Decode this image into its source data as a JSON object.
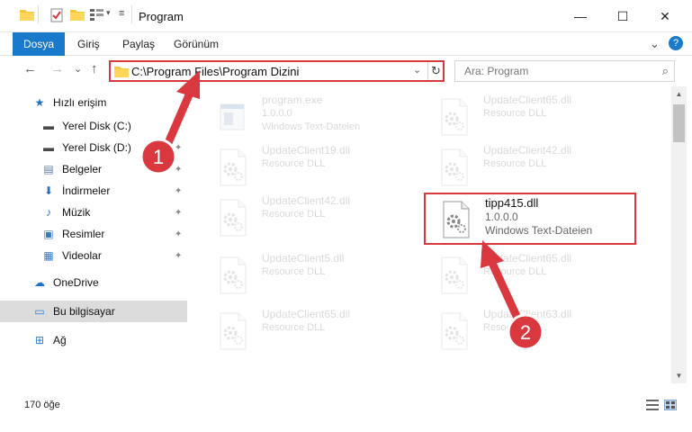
{
  "window": {
    "title": "Program",
    "min_glyph": "—",
    "max_glyph": "☐",
    "close_glyph": "✕"
  },
  "ribbon": {
    "tabs": [
      "Dosya",
      "Giriş",
      "Paylaş",
      "Görünüm"
    ],
    "expand_glyph": "⌄",
    "help_glyph": "?"
  },
  "navigation": {
    "back_glyph": "←",
    "forward_glyph": "→",
    "recent_glyph": "⌄",
    "up_glyph": "↑",
    "address": "C:\\Program Files\\Program Dizini",
    "address_chevron": "⌄",
    "refresh_glyph": "↻",
    "search_placeholder": "Ara: Program",
    "search_glyph": "⌕"
  },
  "sidebar": {
    "items": [
      {
        "label": "Hızlı erişim",
        "icon": "star-icon",
        "glyph": "★",
        "color": "#1f6fc5",
        "pinned": false,
        "selected": false
      },
      {
        "label": "Yerel Disk (C:)",
        "icon": "drive-icon",
        "glyph": "▬",
        "color": "#4a4a4a",
        "pinned": true,
        "selected": false
      },
      {
        "label": "Yerel Disk (D:)",
        "icon": "drive-icon",
        "glyph": "▬",
        "color": "#4a4a4a",
        "pinned": true,
        "selected": false
      },
      {
        "label": "Belgeler",
        "icon": "document-icon",
        "glyph": "▤",
        "color": "#5b7fa8",
        "pinned": true,
        "selected": false
      },
      {
        "label": "İndirmeler",
        "icon": "download-icon",
        "glyph": "⬇",
        "color": "#1f6fc5",
        "pinned": true,
        "selected": false
      },
      {
        "label": "Müzik",
        "icon": "music-icon",
        "glyph": "♪",
        "color": "#1f6fc5",
        "pinned": true,
        "selected": false
      },
      {
        "label": "Resimler",
        "icon": "pictures-icon",
        "glyph": "▣",
        "color": "#3a7bbf",
        "pinned": true,
        "selected": false
      },
      {
        "label": "Videolar",
        "icon": "video-icon",
        "glyph": "▦",
        "color": "#3a7bbf",
        "pinned": true,
        "selected": false
      },
      {
        "label": "OneDrive",
        "icon": "cloud-icon",
        "glyph": "☁",
        "color": "#1f6fc5",
        "pinned": false,
        "selected": false
      },
      {
        "label": "Bu bilgisayar",
        "icon": "computer-icon",
        "glyph": "▭",
        "color": "#2f7fd1",
        "pinned": false,
        "selected": true
      },
      {
        "label": "Ağ",
        "icon": "network-icon",
        "glyph": "⊞",
        "color": "#2f7fd1",
        "pinned": false,
        "selected": false
      }
    ],
    "pin_glyph": "📌"
  },
  "files": [
    {
      "name": "program.exe",
      "line2": "1.0.0.0",
      "line3": "Windows Text-Dateien",
      "kind": "exe",
      "focus": false
    },
    {
      "name": "UpdateClient65.dll",
      "line2": "Resource DLL",
      "line3": "",
      "kind": "dll",
      "focus": false
    },
    {
      "name": "UpdateClient19.dll",
      "line2": "Resource DLL",
      "line3": "",
      "kind": "dll",
      "focus": false
    },
    {
      "name": "UpdateClient42.dll",
      "line2": "Resource DLL",
      "line3": "",
      "kind": "dll",
      "focus": false
    },
    {
      "name": "UpdateClient42.dll",
      "line2": "Resource DLL",
      "line3": "",
      "kind": "dll",
      "focus": false
    },
    {
      "name": "tipp415.dll",
      "line2": "1.0.0.0",
      "line3": "Windows Text-Dateien",
      "kind": "dll",
      "focus": true
    },
    {
      "name": "UpdateClient5.dll",
      "line2": "Resource DLL",
      "line3": "",
      "kind": "dll",
      "focus": false
    },
    {
      "name": "UpdateClient65.dll",
      "line2": "Resource DLL",
      "line3": "",
      "kind": "dll",
      "focus": false
    },
    {
      "name": "UpdateClient65.dll",
      "line2": "Resource DLL",
      "line3": "",
      "kind": "dll",
      "focus": false
    },
    {
      "name": "UpdateClient63.dll",
      "line2": "Resource DLL",
      "line3": "",
      "kind": "dll",
      "focus": false
    }
  ],
  "status": {
    "item_count": "170 öğe"
  },
  "annotations": [
    {
      "number": "1",
      "color": "#d9383f"
    },
    {
      "number": "2",
      "color": "#d9383f"
    }
  ],
  "colors": {
    "accent": "#1979ca",
    "highlight_red": "#d9383f",
    "selected_bg": "#dcdcdc"
  }
}
